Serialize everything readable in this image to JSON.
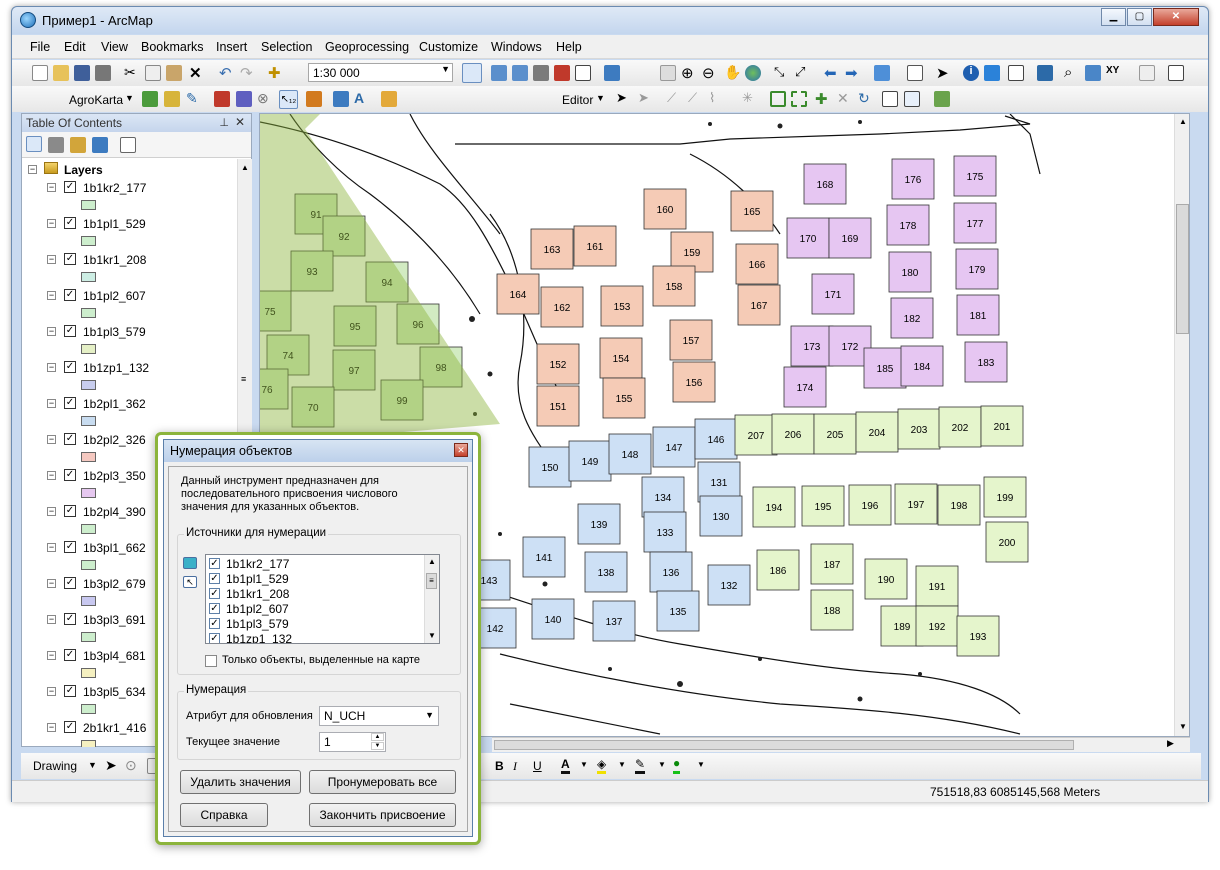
{
  "window": {
    "title": "Пример1 - ArcMap"
  },
  "menu": [
    "File",
    "Edit",
    "View",
    "Bookmarks",
    "Insert",
    "Selection",
    "Geoprocessing",
    "Customize",
    "Windows",
    "Help"
  ],
  "toolbar": {
    "scale": "1:30 000",
    "agrokarta_label": "AgroKarta",
    "editor_label": "Editor"
  },
  "toc": {
    "title": "Table Of Contents",
    "root_label": "Layers",
    "layers": [
      {
        "name": "1b1kr2_177",
        "color": "#cdeecd"
      },
      {
        "name": "1b1pl1_529",
        "color": "#cdeecd"
      },
      {
        "name": "1b1kr1_208",
        "color": "#cdeee4"
      },
      {
        "name": "1b1pl2_607",
        "color": "#cdeecd"
      },
      {
        "name": "1b1pl3_579",
        "color": "#e5f0c6"
      },
      {
        "name": "1b1zp1_132",
        "color": "#c8cdee"
      },
      {
        "name": "1b2pl1_362",
        "color": "#c8dcf0"
      },
      {
        "name": "1b2pl2_326",
        "color": "#f5c8c0"
      },
      {
        "name": "1b2pl3_350",
        "color": "#e6c8f0"
      },
      {
        "name": "1b2pl4_390",
        "color": "#cdeecd"
      },
      {
        "name": "1b3pl1_662",
        "color": "#cdeecd"
      },
      {
        "name": "1b3pl2_679",
        "color": "#c8c8f0"
      },
      {
        "name": "1b3pl3_691",
        "color": "#cdeecd"
      },
      {
        "name": "1b3pl4_681",
        "color": "#f5f0c0"
      },
      {
        "name": "1b3pl5_634",
        "color": "#cdeecd"
      },
      {
        "name": "2b1kr1_416",
        "color": "#f5f0c0"
      }
    ]
  },
  "drawing": {
    "label": "Drawing"
  },
  "status": {
    "coords": "751518,83  6085145,568 Meters"
  },
  "dialog": {
    "title": "Нумерация объектов",
    "description": "Данный инструмент предназначен для последовательного присвоения числового значения для указанных объектов.",
    "sources_label": "Источники для нумерации",
    "sources": [
      "1b1kr2_177",
      "1b1pl1_529",
      "1b1kr1_208",
      "1b1pl2_607",
      "1b1pl3_579",
      "1b1zp1_132"
    ],
    "only_selected_label": "Только объекты, выделенные на карте",
    "numbering_label": "Нумерация",
    "attribute_label": "Атрибут для обновления",
    "attribute_value": "N_UCH",
    "current_label": "Текущее значение",
    "current_value": "1",
    "btn_delete": "Удалить значения",
    "btn_number_all": "Пронумеровать все",
    "btn_help": "Справка",
    "btn_finish": "Закончить присвоение"
  },
  "map": {
    "parcels": [
      {
        "id": "160",
        "color": "#f5cbb6"
      },
      {
        "id": "161",
        "color": "#f5cbb6"
      },
      {
        "id": "163",
        "color": "#f5cbb6"
      },
      {
        "id": "159",
        "color": "#f5cbb6"
      },
      {
        "id": "164",
        "color": "#f5cbb6"
      },
      {
        "id": "162",
        "color": "#f5cbb6"
      },
      {
        "id": "153",
        "color": "#f5cbb6"
      },
      {
        "id": "158",
        "color": "#f5cbb6"
      },
      {
        "id": "157",
        "color": "#f5cbb6"
      },
      {
        "id": "152",
        "color": "#f5cbb6"
      },
      {
        "id": "154",
        "color": "#f5cbb6"
      },
      {
        "id": "156",
        "color": "#f5cbb6"
      },
      {
        "id": "151",
        "color": "#f5cbb6"
      },
      {
        "id": "155",
        "color": "#f5cbb6"
      },
      {
        "id": "165",
        "color": "#f5cbb6"
      },
      {
        "id": "166",
        "color": "#f5cbb6"
      },
      {
        "id": "167",
        "color": "#f5cbb6"
      },
      {
        "id": "168",
        "color": "#e6c6f2"
      },
      {
        "id": "176",
        "color": "#e6c6f2"
      },
      {
        "id": "175",
        "color": "#e6c6f2"
      },
      {
        "id": "170",
        "color": "#e6c6f2"
      },
      {
        "id": "169",
        "color": "#e6c6f2"
      },
      {
        "id": "178",
        "color": "#e6c6f2"
      },
      {
        "id": "177",
        "color": "#e6c6f2"
      },
      {
        "id": "180",
        "color": "#e6c6f2"
      },
      {
        "id": "179",
        "color": "#e6c6f2"
      },
      {
        "id": "171",
        "color": "#e6c6f2"
      },
      {
        "id": "182",
        "color": "#e6c6f2"
      },
      {
        "id": "181",
        "color": "#e6c6f2"
      },
      {
        "id": "173",
        "color": "#e6c6f2"
      },
      {
        "id": "172",
        "color": "#e6c6f2"
      },
      {
        "id": "185",
        "color": "#e6c6f2"
      },
      {
        "id": "184",
        "color": "#e6c6f2"
      },
      {
        "id": "183",
        "color": "#e6c6f2"
      },
      {
        "id": "174",
        "color": "#e6c6f2"
      },
      {
        "id": "150",
        "color": "#cde0f5"
      },
      {
        "id": "149",
        "color": "#cde0f5"
      },
      {
        "id": "148",
        "color": "#cde0f5"
      },
      {
        "id": "147",
        "color": "#cde0f5"
      },
      {
        "id": "146",
        "color": "#cde0f5"
      },
      {
        "id": "131",
        "color": "#cde0f5"
      },
      {
        "id": "134",
        "color": "#cde0f5"
      },
      {
        "id": "139",
        "color": "#cde0f5"
      },
      {
        "id": "133",
        "color": "#cde0f5"
      },
      {
        "id": "130",
        "color": "#cde0f5"
      },
      {
        "id": "141",
        "color": "#cde0f5"
      },
      {
        "id": "138",
        "color": "#cde0f5"
      },
      {
        "id": "136",
        "color": "#cde0f5"
      },
      {
        "id": "132",
        "color": "#cde0f5"
      },
      {
        "id": "143",
        "color": "#cde0f5"
      },
      {
        "id": "140",
        "color": "#cde0f5"
      },
      {
        "id": "137",
        "color": "#cde0f5"
      },
      {
        "id": "135",
        "color": "#cde0f5"
      },
      {
        "id": "142",
        "color": "#cde0f5"
      },
      {
        "id": "207",
        "color": "#e5f5cc"
      },
      {
        "id": "206",
        "color": "#e5f5cc"
      },
      {
        "id": "205",
        "color": "#e5f5cc"
      },
      {
        "id": "204",
        "color": "#e5f5cc"
      },
      {
        "id": "203",
        "color": "#e5f5cc"
      },
      {
        "id": "202",
        "color": "#e5f5cc"
      },
      {
        "id": "201",
        "color": "#e5f5cc"
      },
      {
        "id": "194",
        "color": "#e5f5cc"
      },
      {
        "id": "195",
        "color": "#e5f5cc"
      },
      {
        "id": "196",
        "color": "#e5f5cc"
      },
      {
        "id": "197",
        "color": "#e5f5cc"
      },
      {
        "id": "198",
        "color": "#e5f5cc"
      },
      {
        "id": "199",
        "color": "#e5f5cc"
      },
      {
        "id": "200",
        "color": "#e5f5cc"
      },
      {
        "id": "186",
        "color": "#e5f5cc"
      },
      {
        "id": "187",
        "color": "#e5f5cc"
      },
      {
        "id": "190",
        "color": "#e5f5cc"
      },
      {
        "id": "191",
        "color": "#e5f5cc"
      },
      {
        "id": "188",
        "color": "#e5f5cc"
      },
      {
        "id": "189",
        "color": "#e5f5cc"
      },
      {
        "id": "192",
        "color": "#e5f5cc"
      },
      {
        "id": "193",
        "color": "#e5f5cc"
      },
      {
        "id": "91",
        "color": "#d2ebc2"
      },
      {
        "id": "92",
        "color": "#d2ebc2"
      },
      {
        "id": "93",
        "color": "#d2ebc2"
      },
      {
        "id": "94",
        "color": "#d2ebc2"
      },
      {
        "id": "75",
        "color": "#d2ebc2"
      },
      {
        "id": "95",
        "color": "#d2ebc2"
      },
      {
        "id": "96",
        "color": "#d2ebc2"
      },
      {
        "id": "74",
        "color": "#d2ebc2"
      },
      {
        "id": "97",
        "color": "#d2ebc2"
      },
      {
        "id": "98",
        "color": "#d2ebc2"
      },
      {
        "id": "76",
        "color": "#d2ebc2"
      },
      {
        "id": "99",
        "color": "#d2ebc2"
      },
      {
        "id": "70",
        "color": "#d2ebc2"
      }
    ]
  }
}
